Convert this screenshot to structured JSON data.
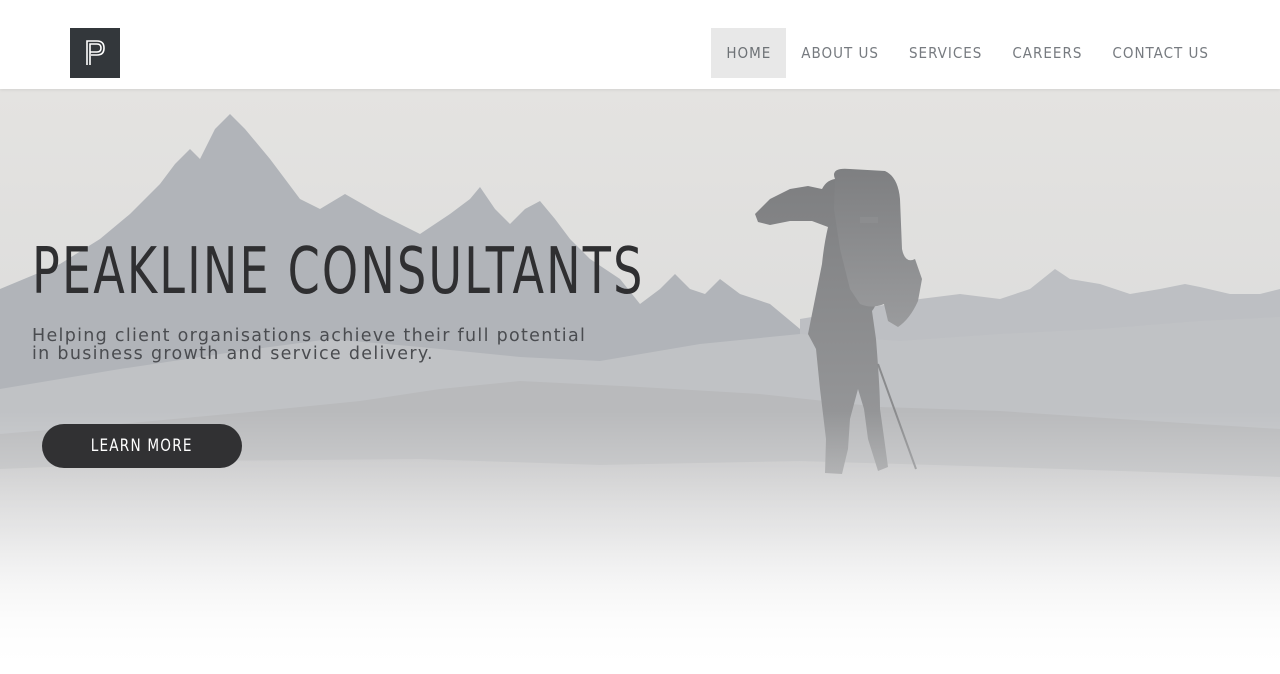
{
  "header": {
    "logo_icon": "p-monogram-logo",
    "nav": {
      "home": "HOME",
      "about": "ABOUT US",
      "services": "SERVICES",
      "careers": "CAREERS",
      "contact": "CONTACT US"
    },
    "active_item": "home"
  },
  "hero": {
    "title": "PEAKLINE CONSULTANTS",
    "subtitle_line1": "Helping client organisations achieve their full potential",
    "subtitle_line2": "in business growth and service delivery.",
    "cta_label": "LEARN MORE",
    "background_image": "hiker-silhouette-mountain-landscape"
  },
  "colors": {
    "nav_text": "#777b80",
    "nav_active_bg": "#e8e8e8",
    "logo_bg": "#33373b",
    "title_text": "#2f2f31",
    "cta_bg": "#313133",
    "cta_text": "#ffffff"
  }
}
